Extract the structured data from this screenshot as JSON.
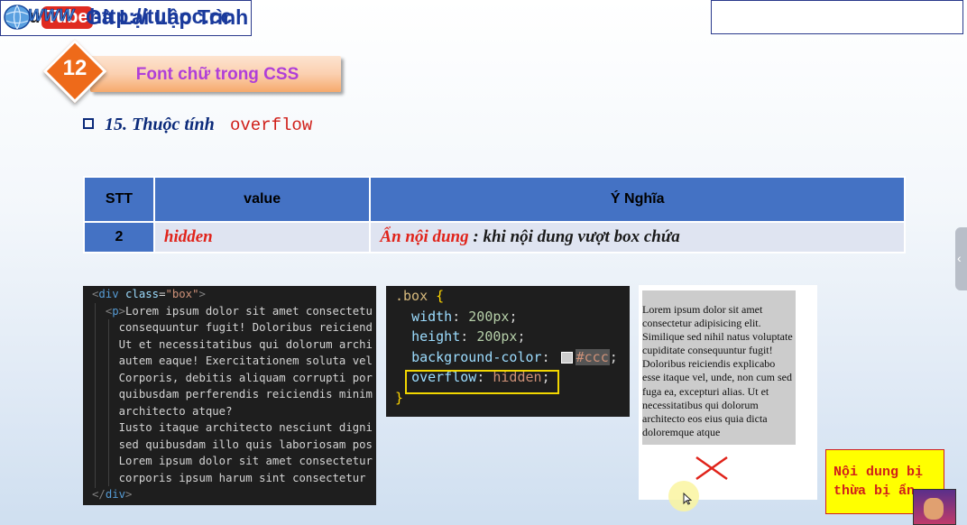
{
  "header": {
    "youtube_you": "You",
    "youtube_tube": "Tube",
    "channel_name": "Gà Lại Lập Trình",
    "website_icon": "www-globe-icon",
    "website_url": "http://tuhoc.cc"
  },
  "section": {
    "number": "12",
    "title": "Font chữ trong CSS"
  },
  "subtitle": {
    "text": "15. Thuộc tính",
    "code": "overflow"
  },
  "table": {
    "headers": [
      "STT",
      "value",
      "Ý Nghĩa"
    ],
    "rows": [
      {
        "stt": "2",
        "value": "hidden",
        "meaning_highlight": "Ẩn nội dung",
        "meaning_rest": " : khi nội dung vượt box chứa"
      }
    ]
  },
  "html_code": {
    "open_tag": "div",
    "class_attr": "class",
    "class_value": "\"box\"",
    "p_tag": "p",
    "lines": [
      "Lorem ipsum dolor sit amet consectetu",
      "consequuntur fugit! Doloribus reiciend",
      "Ut et necessitatibus qui dolorum archi",
      "autem eaque! Exercitationem soluta vel",
      "Corporis, debitis aliquam corrupti por",
      "quibusdam perferendis reiciendis minim",
      "architecto atque?",
      "Iusto itaque architecto nesciunt digni",
      "sed quibusdam illo quis laboriosam pos",
      "Lorem ipsum dolor sit amet consectetur",
      "corporis ipsum harum sint consectetur"
    ],
    "close_tag": "div"
  },
  "css_code": {
    "selector": ".box",
    "open_brace": "{",
    "close_brace": "}",
    "width_prop": "width",
    "width_val": "200px",
    "height_prop": "height",
    "height_val": "200px",
    "bg_prop": "background-color",
    "bg_val": "#ccc",
    "overflow_prop": "overflow",
    "overflow_val": "hidden"
  },
  "preview": {
    "text": "Lorem ipsum dolor sit amet consectetur adipisicing elit. Similique sed nihil natus voluptate cupiditate consequuntur fugit! Doloribus reiciendis explicabo esse itaque vel, unde, non cum sed fuga ea, excepturi alias. Ut et necessitatibus qui dolorum architecto eos eius quia dicta doloremque atque"
  },
  "note": {
    "line1": "Nội dung bị",
    "line2": "thừa bị ẩn"
  },
  "colors": {
    "accent_blue": "#4472c4",
    "title_purple": "#b03fd8",
    "badge_orange": "#ee6a1a",
    "highlight_yellow": "#f2d700",
    "red": "#e0231a"
  }
}
